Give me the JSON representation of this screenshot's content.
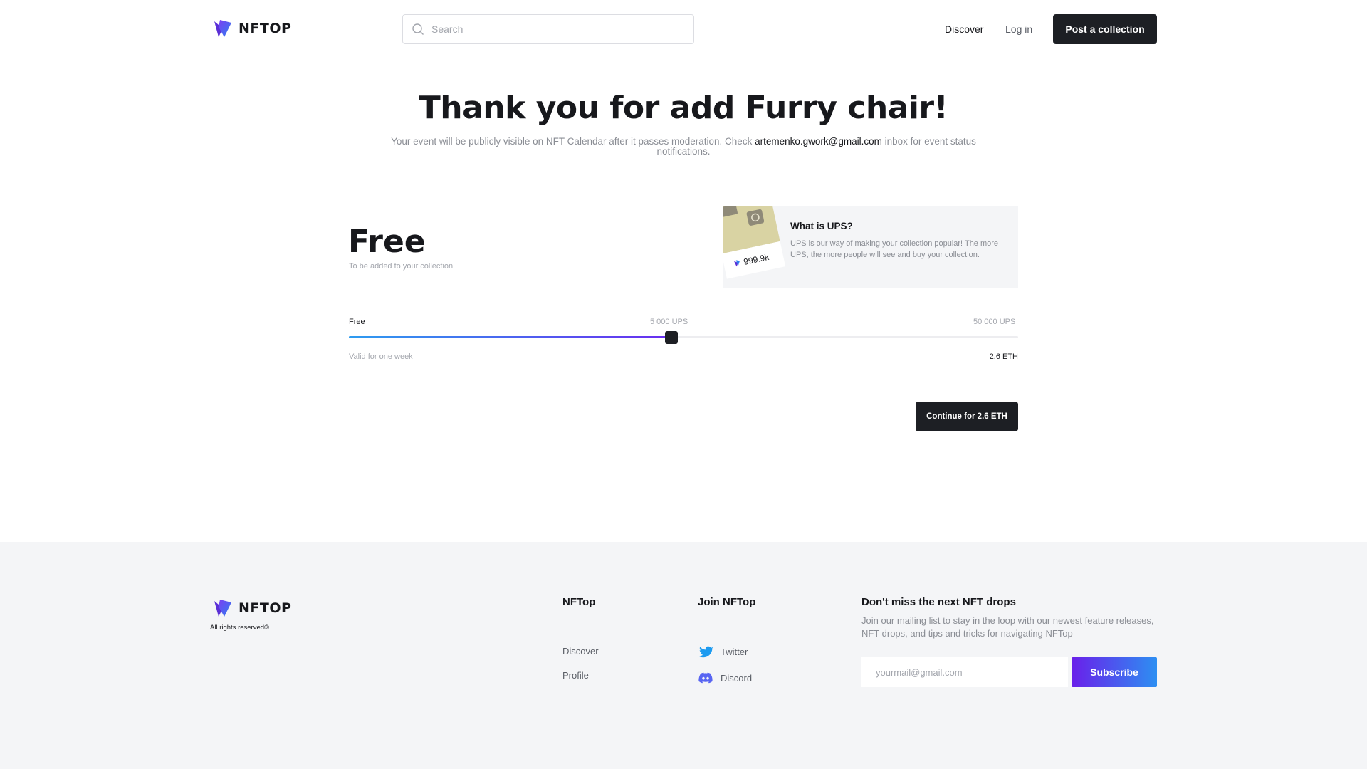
{
  "brand": {
    "name": "NFTOP",
    "rights": "All rights reserved©"
  },
  "header": {
    "search_placeholder": "Search",
    "nav_discover": "Discover",
    "nav_login": "Log in",
    "post_button": "Post a collection"
  },
  "hero": {
    "title": "Thank you for add Furry chair!",
    "subtitle_before": "Your event will be publicly visible on NFT Calendar after it passes moderation. Check ",
    "email": "artemenko.gwork@gmail.com",
    "subtitle_after": " inbox for event status notifications."
  },
  "pricing": {
    "plan_title": "Free",
    "plan_desc": "To be added to your collection",
    "ups_info": {
      "title": "What is UPS?",
      "text": "UPS is our way of making your collection popular! The more UPS, the more people will see and buy your collection.",
      "thumb_stat": "999.9k"
    },
    "slider": {
      "label_min": "Free",
      "label_mid": "5 000 UPS",
      "label_max": "50 000 UPS",
      "value_fraction": 0.482,
      "validity": "Valid for one week",
      "price": "2.6 ETH"
    },
    "continue_button": "Continue for 2.6 ETH"
  },
  "footer": {
    "col1_title": "NFTop",
    "col1_links": [
      "Discover",
      "Profile"
    ],
    "col2_title": "Join NFTop",
    "social": [
      {
        "label": "Twitter",
        "icon": "twitter-icon",
        "color": "#1d9bf0"
      },
      {
        "label": "Discord",
        "icon": "discord-icon",
        "color": "#5865f2"
      }
    ],
    "newsletter": {
      "title": "Don't miss the next NFT drops",
      "text": "Join our mailing list to stay in the loop with our newest feature releases, NFT drops, and tips and tricks for navigating NFTop",
      "email_placeholder": "yourmail@gmail.com",
      "subscribe_button": "Subscribe"
    }
  },
  "colors": {
    "accent_dark": "#1d1f24",
    "gradient_start": "#2d9cf0",
    "gradient_end": "#6a2df0"
  }
}
